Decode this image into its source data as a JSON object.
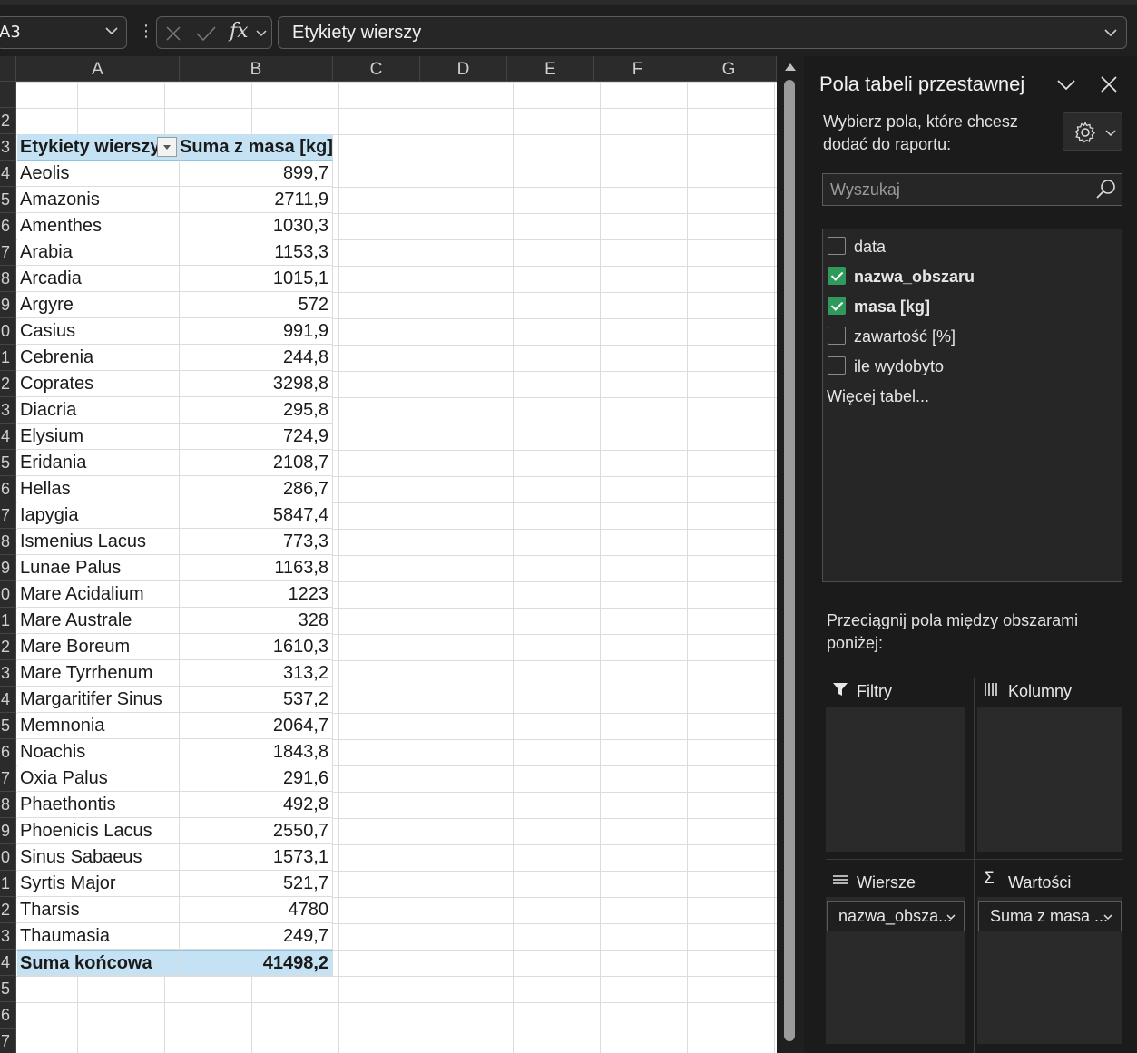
{
  "formula_bar": {
    "name_box": "A3",
    "formula": "Etykiety wierszy",
    "fx_label": "fx"
  },
  "columns": [
    "A",
    "B",
    "C",
    "D",
    "E",
    "F",
    "G"
  ],
  "row_numbers": [
    "",
    "2",
    "3",
    "4",
    "5",
    "6",
    "7",
    "8",
    "9",
    "0",
    "1",
    "2",
    "3",
    "4",
    "5",
    "6",
    "7",
    "8",
    "9",
    "0",
    "1",
    "2",
    "3",
    "4",
    "5",
    "6",
    "7",
    "8",
    "9",
    "0",
    "1",
    "2",
    "3",
    "4",
    "5",
    "6",
    "7"
  ],
  "pivot_table": {
    "header": {
      "label": "Etykiety wierszy",
      "value": "Suma z masa [kg]"
    },
    "rows": [
      {
        "label": "Aeolis",
        "value": "899,7"
      },
      {
        "label": "Amazonis",
        "value": "2711,9"
      },
      {
        "label": "Amenthes",
        "value": "1030,3"
      },
      {
        "label": "Arabia",
        "value": "1153,3"
      },
      {
        "label": "Arcadia",
        "value": "1015,1"
      },
      {
        "label": "Argyre",
        "value": "572"
      },
      {
        "label": "Casius",
        "value": "991,9"
      },
      {
        "label": "Cebrenia",
        "value": "244,8"
      },
      {
        "label": "Coprates",
        "value": "3298,8"
      },
      {
        "label": "Diacria",
        "value": "295,8"
      },
      {
        "label": "Elysium",
        "value": "724,9"
      },
      {
        "label": "Eridania",
        "value": "2108,7"
      },
      {
        "label": "Hellas",
        "value": "286,7"
      },
      {
        "label": "Iapygia",
        "value": "5847,4"
      },
      {
        "label": "Ismenius Lacus",
        "value": "773,3"
      },
      {
        "label": "Lunae Palus",
        "value": "1163,8"
      },
      {
        "label": "Mare Acidalium",
        "value": "1223"
      },
      {
        "label": "Mare Australe",
        "value": "328"
      },
      {
        "label": "Mare Boreum",
        "value": "1610,3"
      },
      {
        "label": "Mare Tyrrhenum",
        "value": "313,2"
      },
      {
        "label": "Margaritifer Sinus",
        "value": "537,2"
      },
      {
        "label": "Memnonia",
        "value": "2064,7"
      },
      {
        "label": "Noachis",
        "value": "1843,8"
      },
      {
        "label": "Oxia Palus",
        "value": "291,6"
      },
      {
        "label": "Phaethontis",
        "value": "492,8"
      },
      {
        "label": "Phoenicis Lacus",
        "value": "2550,7"
      },
      {
        "label": "Sinus Sabaeus",
        "value": "1573,1"
      },
      {
        "label": "Syrtis Major",
        "value": "521,7"
      },
      {
        "label": "Tharsis",
        "value": "4780"
      },
      {
        "label": "Thaumasia",
        "value": "249,7"
      }
    ],
    "total": {
      "label": "Suma końcowa",
      "value": "41498,2"
    }
  },
  "pane": {
    "title": "Pola tabeli przestawnej",
    "description": "Wybierz pola, które chcesz dodać do raportu:",
    "search_placeholder": "Wyszukaj",
    "fields": [
      {
        "label": "data",
        "checked": false
      },
      {
        "label": "nazwa_obszaru",
        "checked": true
      },
      {
        "label": "masa [kg]",
        "checked": true
      },
      {
        "label": "zawartość [%]",
        "checked": false
      },
      {
        "label": "ile wydobyto",
        "checked": false
      }
    ],
    "more_tables": "Więcej tabel...",
    "drag_hint": "Przeciągnij pola między obszarami poniżej:",
    "areas": {
      "filters": "Filtry",
      "columns": "Kolumny",
      "rows": "Wiersze",
      "values": "Wartości"
    },
    "rows_pill": "nazwa_obsza...",
    "values_pill": "Suma z masa ...",
    "accent_color": "#2f9a5c"
  }
}
